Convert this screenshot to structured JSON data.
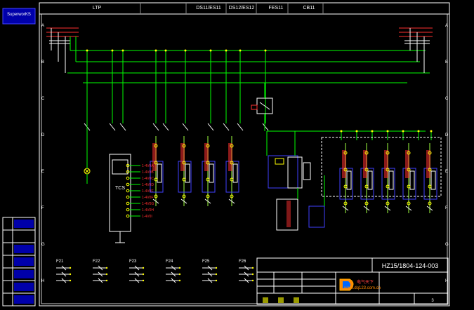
{
  "header": {
    "cells": [
      {
        "line1": "LTP",
        "line2": ""
      },
      {
        "line1": "",
        "line2": ""
      },
      {
        "line1": "DS11/ES11",
        "line2": ""
      },
      {
        "line1": "DS12/ES12",
        "line2": ""
      },
      {
        "line1": "FES11",
        "line2": ""
      },
      {
        "line1": "CB11",
        "line2": ""
      }
    ]
  },
  "left_panel": {
    "brand": "SuperworKS",
    "rows": [
      "",
      "",
      "",
      "",
      "",
      "",
      ""
    ]
  },
  "border": {
    "row_letters": [
      "A",
      "B",
      "C",
      "D",
      "E",
      "F",
      "G",
      "H"
    ]
  },
  "title_block": {
    "title": "",
    "drawing_no": "HZ15/1804-124-003",
    "website": "www.dq123.com.cn",
    "logo_text": "电气天下",
    "slogan": "",
    "fields": [
      "",
      "",
      "",
      "",
      "",
      ""
    ]
  },
  "terminals": {
    "left": [
      "1-4V0A",
      "1-4V0B",
      "1-4V0C",
      "1-4V0D",
      "1-4V0E",
      "1-4V0F",
      "1-4V0G",
      "1-4V0H",
      "1-4V0I"
    ],
    "module": "TCS"
  },
  "bottom_switches": [
    "F21",
    "F22",
    "F23",
    "F24",
    "F25",
    "F26"
  ],
  "colors": {
    "background": "#000000",
    "frame": "#ffffff",
    "bus": "#00ff00",
    "wire": "#a0ff40",
    "red": "#ff3030",
    "yellow": "#ffff00",
    "blue": "#4040ff",
    "cyan": "#00c8ff",
    "magenta": "#ff40ff"
  }
}
